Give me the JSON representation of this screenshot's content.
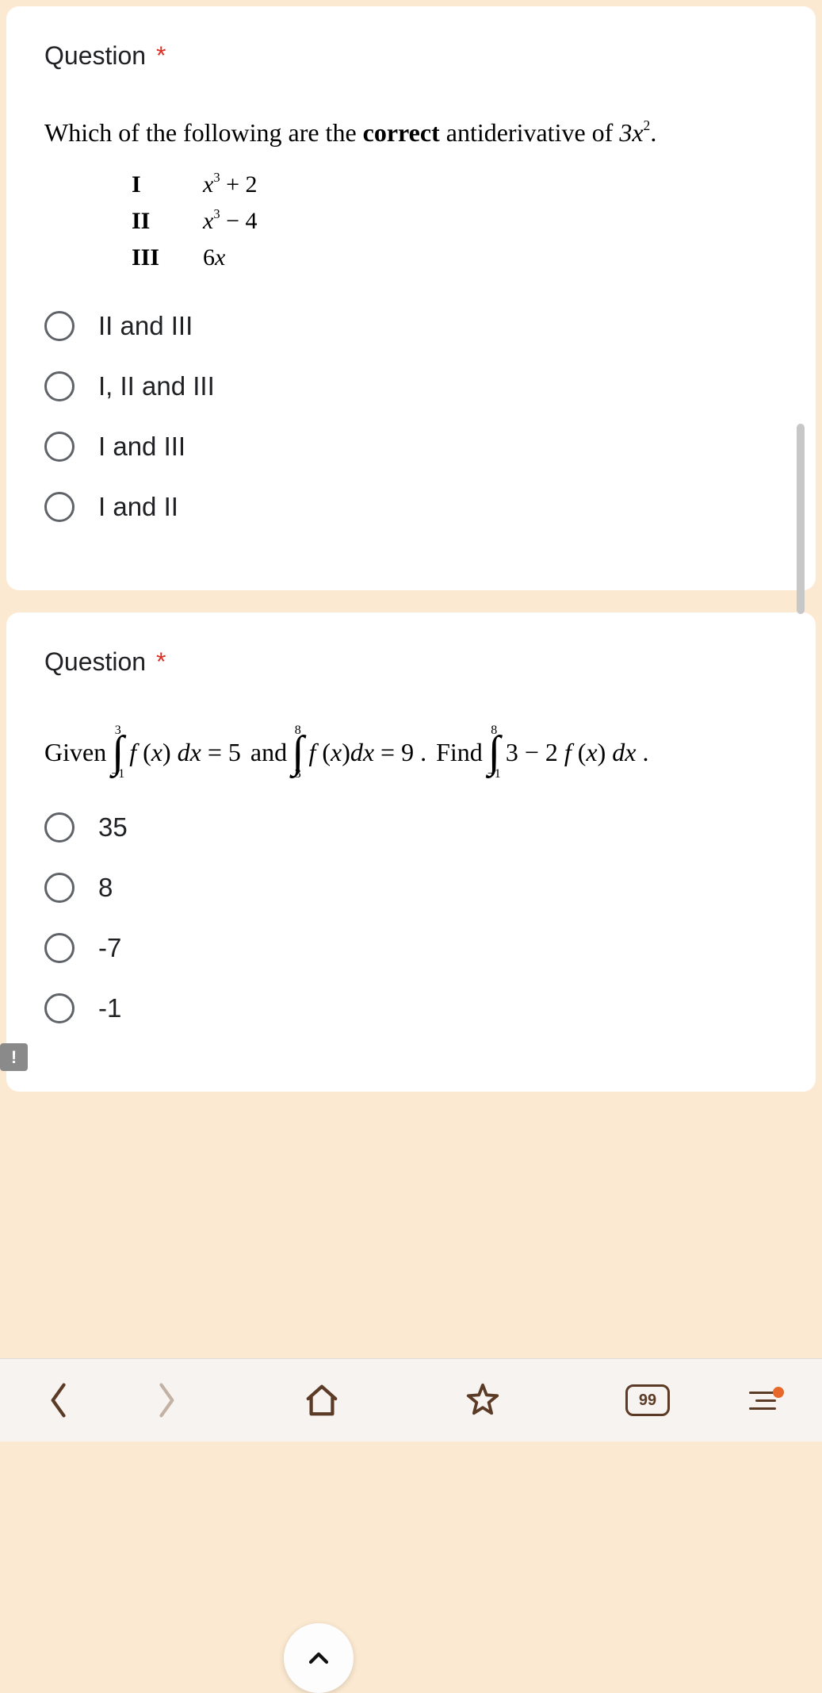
{
  "q1": {
    "title": "Question",
    "required": "*",
    "prompt_pre": "Which  of the following are the ",
    "prompt_bold": "correct",
    "prompt_post": " antiderivative of ",
    "prompt_expr_base": "3x",
    "prompt_expr_sup": "2",
    "prompt_period": ".",
    "rows": {
      "r1_num": "I",
      "r1_base": "x",
      "r1_sup": "3",
      "r1_rest": " + 2",
      "r2_num": "II",
      "r2_base": "x",
      "r2_sup": "3",
      "r2_rest": " − 4",
      "r3_num": "III",
      "r3_expr": "6x"
    },
    "options": {
      "o1": "II and III",
      "o2": "I, II and III",
      "o3": "I and III",
      "o4": "I and II"
    }
  },
  "q2": {
    "title": "Question",
    "required": "*",
    "given": "Given ",
    "int1_upper": "3",
    "int1_lower": "−1",
    "fxdx1": "f (x) dx = 5 ",
    "and": " and ",
    "int2_upper": "8",
    "int2_lower": "3",
    "fxdx2": "f (x)dx = 9 . ",
    "find": "Find ",
    "int3_upper": "8",
    "int3_lower": "−1",
    "fxdx3": "3 − 2 f (x) dx .",
    "options": {
      "o1": "35",
      "o2": "8",
      "o3": "-7",
      "o4": "-1"
    }
  },
  "nav": {
    "tabs": "99"
  },
  "bang": "!"
}
